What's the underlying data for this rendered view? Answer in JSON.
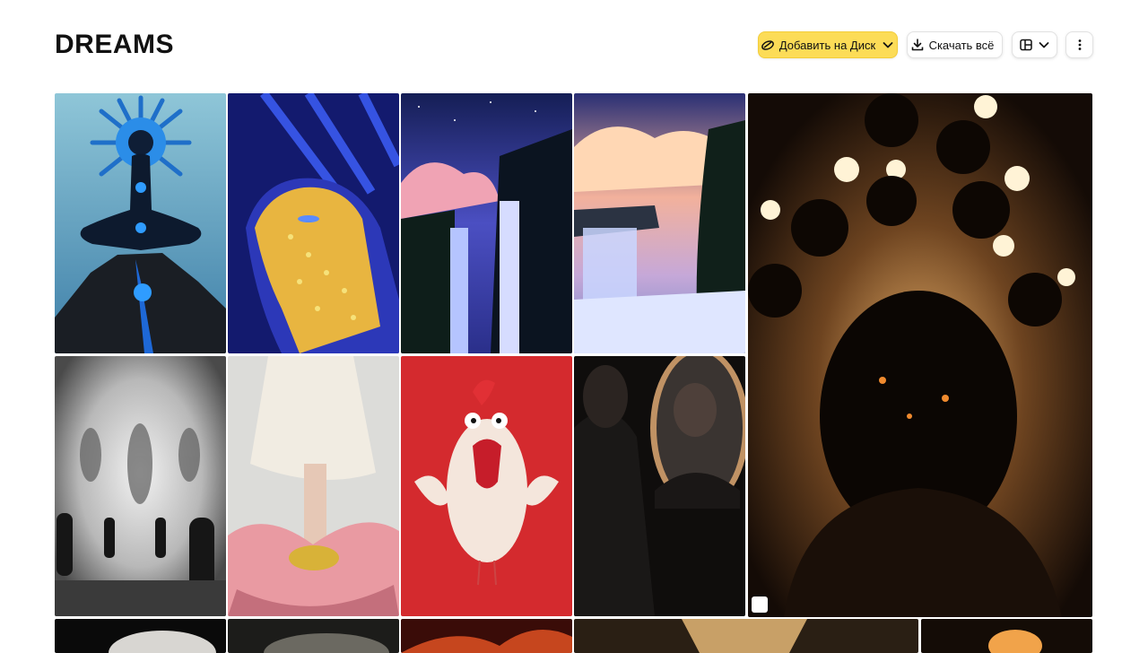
{
  "album": {
    "title": "DREAMS"
  },
  "toolbar": {
    "add_to_disk_label": "Добавить на Диск",
    "download_all_label": "Скачать всё",
    "add_icon": "disk-icon",
    "download_icon": "download-icon",
    "view_icon": "layout-icon",
    "more_icon": "more-vertical-icon",
    "accent_color": "#fcdc57"
  },
  "photos": [
    {
      "name": "photo-meditation"
    },
    {
      "name": "photo-golden-face"
    },
    {
      "name": "photo-night-waterfall"
    },
    {
      "name": "photo-sunset-waterfall"
    },
    {
      "name": "photo-glowing-head"
    },
    {
      "name": "photo-fog-figures"
    },
    {
      "name": "photo-flower-dress"
    },
    {
      "name": "photo-screaming-chicken"
    },
    {
      "name": "photo-mirror-man"
    },
    {
      "name": "photo-row3-1"
    },
    {
      "name": "photo-row3-2"
    },
    {
      "name": "photo-row3-3"
    },
    {
      "name": "photo-row3-4"
    },
    {
      "name": "photo-row3-5"
    }
  ]
}
